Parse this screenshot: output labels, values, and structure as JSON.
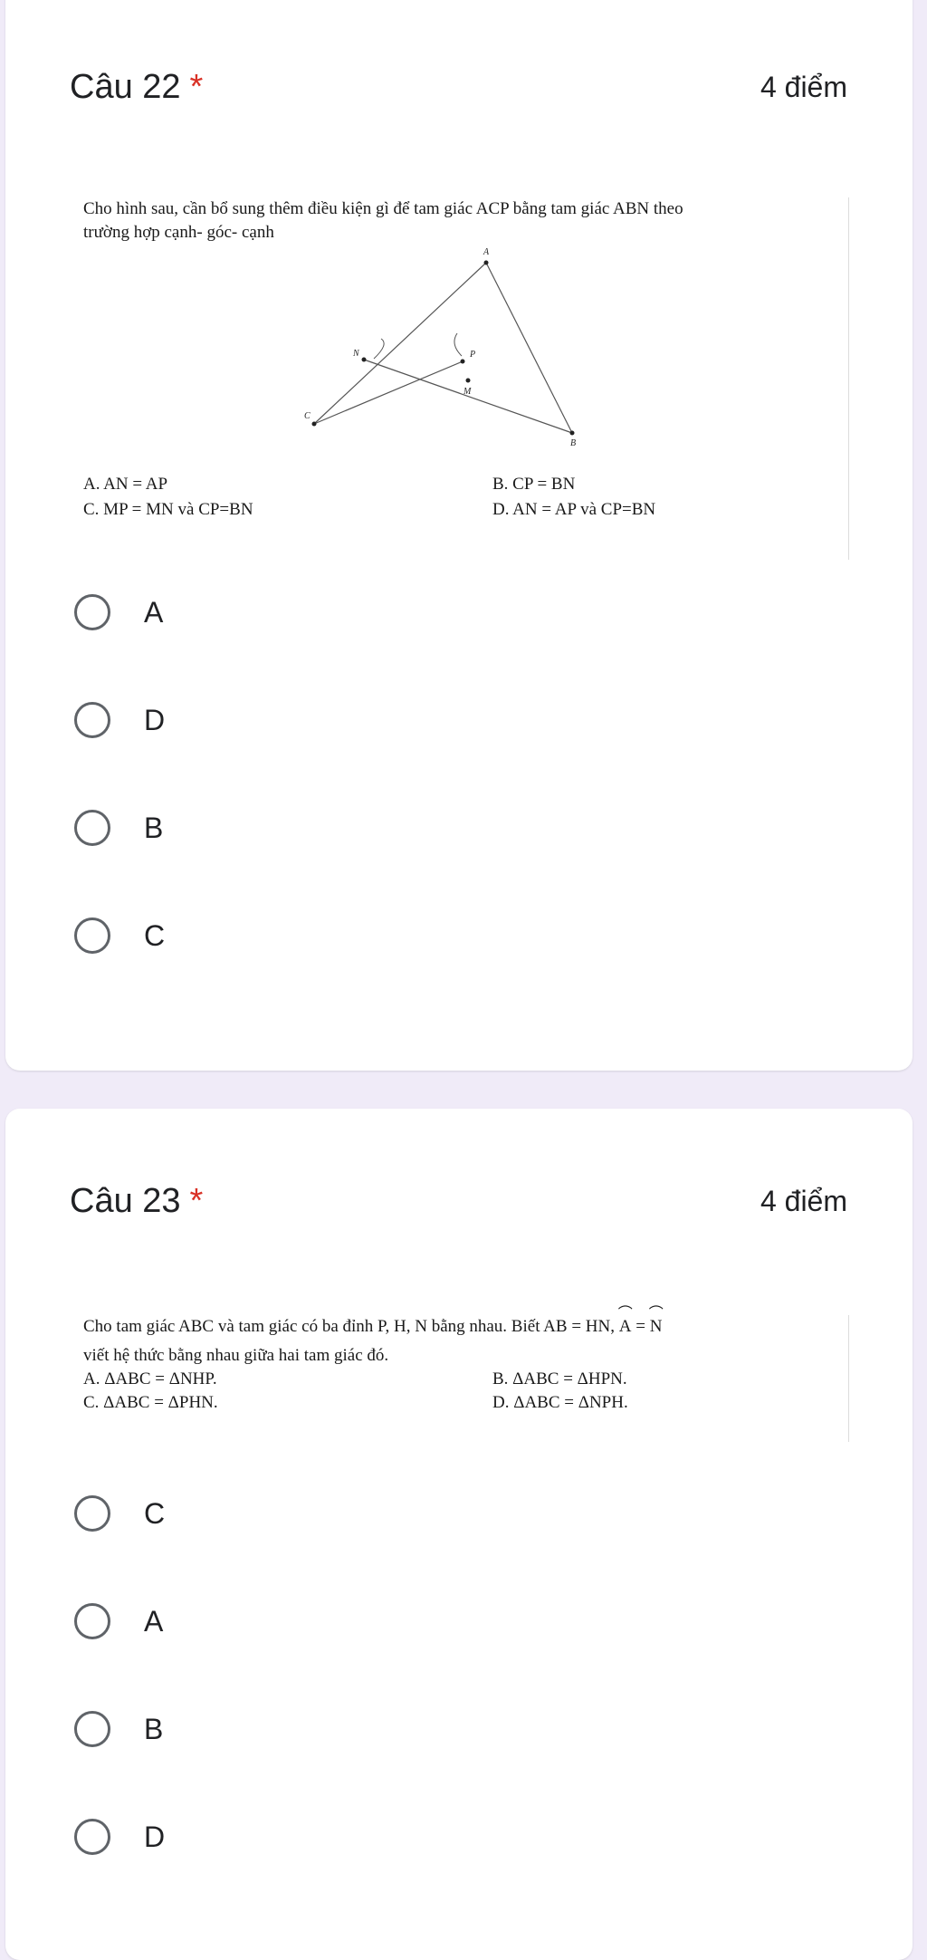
{
  "q22": {
    "title": "Câu 22",
    "required": "*",
    "points": "4 điểm",
    "text_line1": "Cho hình sau, cần bổ sung thêm điều kiện gì để tam giác ACP bằng tam giác ABN theo",
    "text_line2": "trường hợp cạnh- góc- cạnh",
    "figure_labels": {
      "A": "A",
      "N": "N",
      "P": "P",
      "M": "M",
      "C": "C",
      "B": "B"
    },
    "opt_a": "A. AN = AP",
    "opt_b": "B. CP = BN",
    "opt_c": "C. MP = MN  và CP=BN",
    "opt_d": "D. AN = AP  và CP=BN",
    "choices": [
      "A",
      "D",
      "B",
      "C"
    ]
  },
  "q23": {
    "title": "Câu 23",
    "required": "*",
    "points": "4 điểm",
    "text_line1": "Cho tam giác ABC và tam giác có ba đỉnh P, H, N bằng nhau. Biết AB = HN,",
    "hat_a": "A",
    "eq": " = ",
    "hat_n": "N",
    "text_line2": "viết hệ thức bằng nhau giữa hai tam giác đó.",
    "opt_a": "A. ΔABC = ΔNHP.",
    "opt_b": "B. ΔABC = ΔHPN.",
    "opt_c": "C. ΔABC = ΔPHN.",
    "opt_d": "D. ΔABC = ΔNPH.",
    "choices": [
      "C",
      "A",
      "B",
      "D"
    ]
  }
}
